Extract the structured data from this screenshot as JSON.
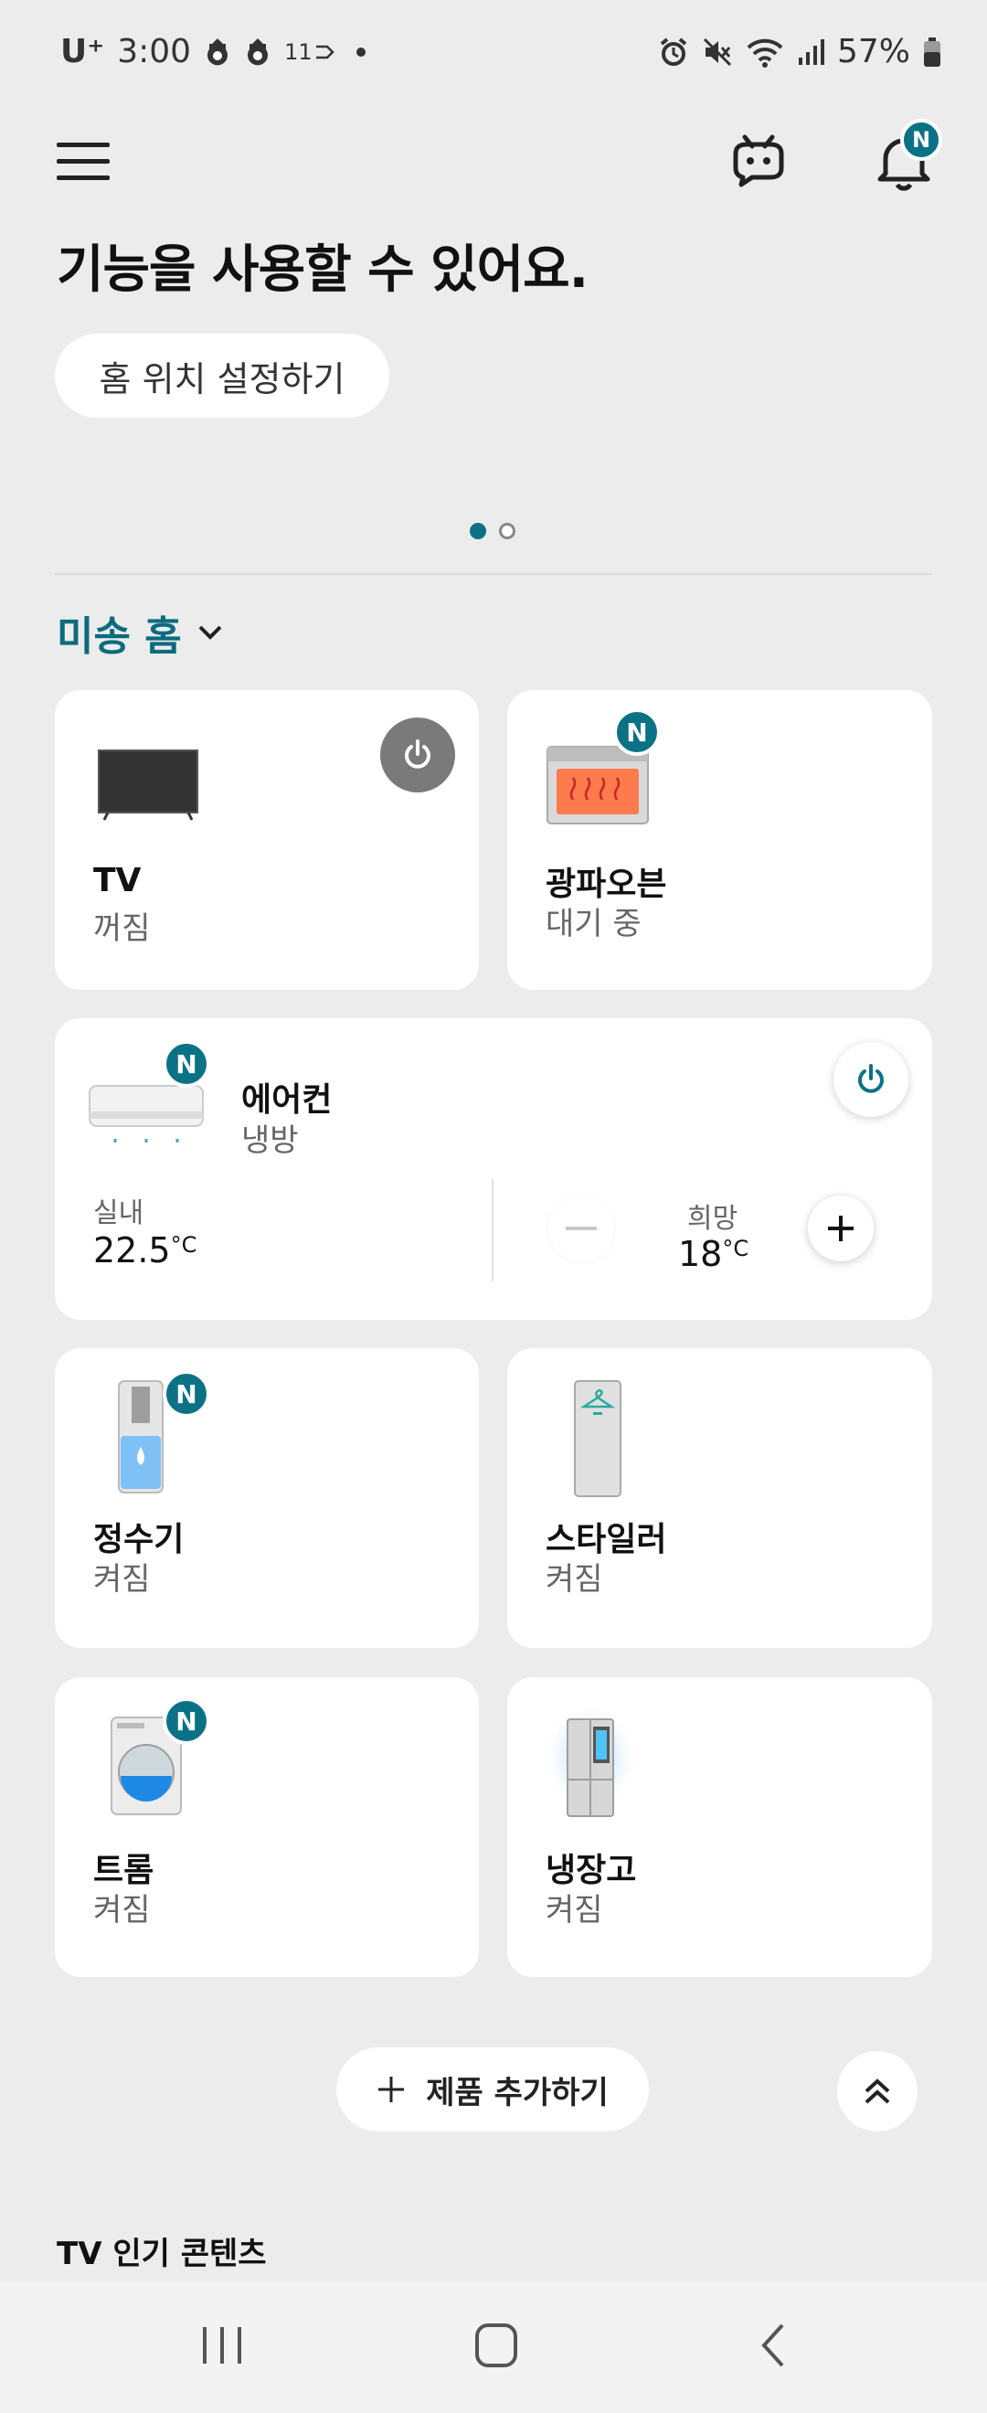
{
  "status_bar": {
    "carrier": "U⁺",
    "time": "3:00",
    "notif_11": "11",
    "battery": "57%"
  },
  "header": {
    "menu_icon": "hamburger-icon",
    "bot_icon": "chatbot-icon",
    "bell_icon": "bell-icon",
    "bell_badge": "N"
  },
  "banner": {
    "heading": "기능을 사용할 수 있어요.",
    "home_location_button": "홈 위치 설정하기",
    "page_dots": 2,
    "active_dot": 0
  },
  "home": {
    "name": "미송 홈"
  },
  "devices": {
    "tv": {
      "name": "TV",
      "status": "꺼짐",
      "icon": "tv-icon"
    },
    "oven": {
      "name": "광파오븐",
      "status": "대기 중",
      "badge": "N",
      "icon": "oven-icon"
    },
    "aircon": {
      "name": "에어컨",
      "status": "냉방",
      "badge": "N",
      "icon": "air-conditioner-icon",
      "indoor_label": "실내",
      "indoor_value": "22.5",
      "unit": "°C",
      "target_label": "희망",
      "target_value": "18"
    },
    "purifier": {
      "name": "정수기",
      "status": "켜짐",
      "badge": "N",
      "icon": "water-purifier-icon"
    },
    "styler": {
      "name": "스타일러",
      "status": "켜짐",
      "icon": "styler-icon"
    },
    "washer": {
      "name": "트롬",
      "status": "켜짐",
      "badge": "N",
      "icon": "washer-icon"
    },
    "fridge": {
      "name": "냉장고",
      "status": "켜짐",
      "icon": "refrigerator-icon"
    }
  },
  "actions": {
    "add_product": "제품 추가하기",
    "scroll_top_icon": "double-chevron-up-icon"
  },
  "sections": {
    "tv_popular": "TV 인기 콘텐츠"
  },
  "colors": {
    "accent": "#0b7285",
    "home_name": "#0b6b7e",
    "background": "#ececec"
  }
}
